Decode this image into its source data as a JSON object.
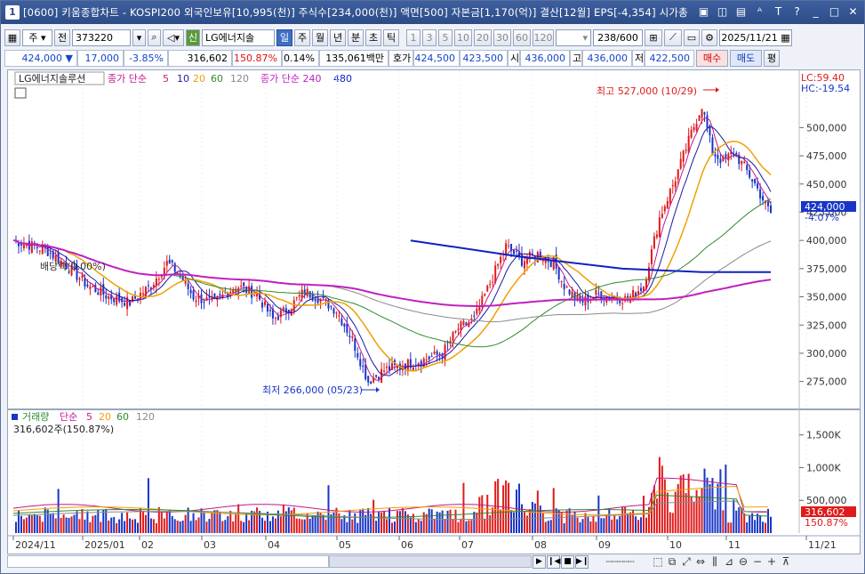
{
  "window": {
    "number": "1",
    "title": "[0600] 키움종합차트 - KOSPI200 외국인보유[10,995(천)] 주식수[234,000(천)] 액면[500] 자본금[1,170(억)] 결산[12월] EPS[-4,354] 시가총",
    "icons": [
      "window-icon",
      "restore-icon",
      "tile-icon",
      "font-icon",
      "T",
      "help-icon",
      "minimize-icon",
      "maximize-icon",
      "close-icon"
    ]
  },
  "toolbar": {
    "type": "주",
    "all": "전",
    "code": "373220",
    "name_badge": "신",
    "name": "LG에너지솔",
    "periods": [
      "일",
      "주",
      "월",
      "년",
      "분",
      "초",
      "틱"
    ],
    "active_period": "일",
    "minutes": [
      "1",
      "3",
      "5",
      "10",
      "20",
      "30",
      "60",
      "120"
    ],
    "count": "238",
    "count_total": "/600",
    "date": "2025/11/21"
  },
  "quote": {
    "price": "424,000",
    "arrow": "▼",
    "change": "17,000",
    "change_pct": "-3.85%",
    "volume": "316,602",
    "vol_ratio": "150.87%",
    "turnover": "0.14%",
    "amount": "135,061백만",
    "hoga_label": "호가",
    "bid": "424,500",
    "ask": "423,500",
    "open_label": "시",
    "open": "436,000",
    "high_label": "고",
    "high": "436,000",
    "low_label": "저",
    "low": "422,500",
    "buy": "매수",
    "sell": "매도",
    "eval": "평"
  },
  "price_legend": {
    "name": "LG에너지솔루션",
    "ma_label": "종가 단순",
    "ma_periods": [
      "5",
      "10",
      "20",
      "60",
      "120"
    ],
    "ma2_label": "종가 단순 240",
    "ma2_period": "480",
    "lc": "LC:59.40",
    "hc": "HC:-19.54",
    "max_label": "최고 527,000 (10/29)",
    "min_label": "최저 266,000 (05/23)",
    "dividend": "배당락(0.00%)",
    "current_tag": "424,000",
    "current_pct": "-4.07%"
  },
  "volume_legend": {
    "label": "거래량",
    "ma_label": "단순",
    "ma_periods": [
      "5",
      "20",
      "60",
      "120"
    ],
    "current": "316,602주(150.87%)",
    "tag_value": "316,602",
    "tag_pct": "150.87%"
  },
  "colors": {
    "up": "#e01a1a",
    "down": "#1835c8",
    "ma5": "#c2188b",
    "ma10": "#1a1aa0",
    "ma20": "#f0a000",
    "ma60": "#2e8b2e",
    "ma120": "#8a8a8a",
    "ma240": "#c020c0",
    "ma480": "#1020c0"
  },
  "chart_data": {
    "type": "candlestick",
    "price_axis": [
      "500,000",
      "475,000",
      "450,000",
      "425,000",
      "400,000",
      "375,000",
      "350,000",
      "325,000",
      "300,000",
      "275,000"
    ],
    "price_ylim": [
      255000,
      535000
    ],
    "volume_axis": [
      "1,500K",
      "1,000K",
      "500,000"
    ],
    "volume_ylim": [
      0,
      1700000
    ],
    "x_labels": [
      "2024/11",
      "2025/01",
      "02",
      "03",
      "04",
      "05",
      "06",
      "07",
      "08",
      "09",
      "10",
      "11",
      "11/21"
    ],
    "max_value": 527000,
    "min_value": 266000,
    "last_close": 424000
  }
}
